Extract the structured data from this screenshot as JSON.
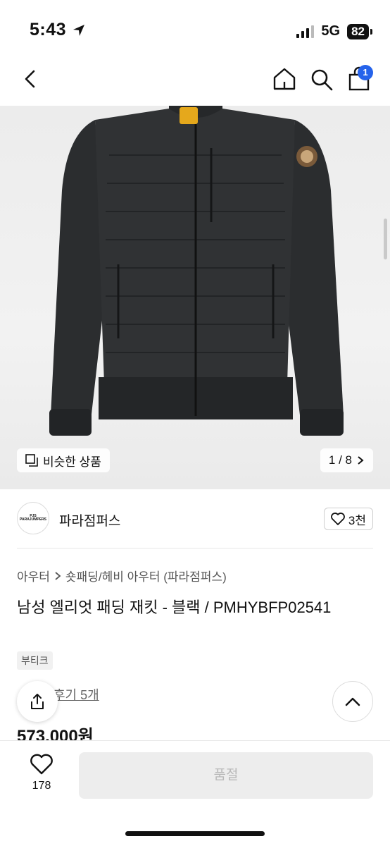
{
  "status": {
    "time": "5:43",
    "network": "5G",
    "battery": "82"
  },
  "nav": {
    "cart_badge": "1"
  },
  "image": {
    "similar_label": "비슷한 상품",
    "page_indicator": "1 / 8"
  },
  "shop": {
    "logo_line1": "PJS",
    "logo_line2": "PARAJUMPERS",
    "name": "파라점퍼스",
    "likes": "3천"
  },
  "breadcrumb": {
    "level1": "아우터",
    "level2": "숏패딩/헤비 아우터 (파라점퍼스)"
  },
  "product": {
    "title": "남성 엘리엇 패딩 재킷 - 블랙 / PMHYBFP02541",
    "tag": "부티크",
    "review": "후기 5개",
    "price": "573,000원"
  },
  "bottom": {
    "favorite_count": "178",
    "cta_label": "품절"
  },
  "colors": {
    "accent": "#2563eb",
    "soldout_bg": "#ededed"
  }
}
